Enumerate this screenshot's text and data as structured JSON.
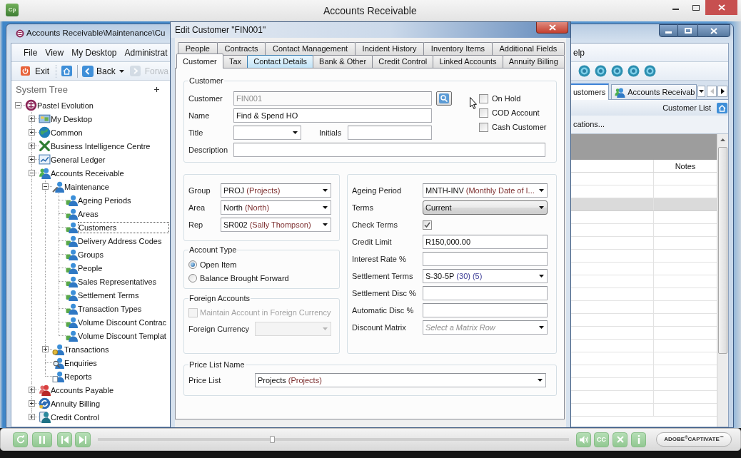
{
  "player": {
    "app_icon": "Cp",
    "title": "Accounts Receivable",
    "level": 0.37,
    "captions": "CC",
    "logo": "ADOBE$^{®}$CAPTIVATE$^{™}$"
  },
  "app_window": {
    "title": "Accounts Receivable\\Maintenance\\Cu",
    "menu": [
      "File",
      "View",
      "My Desktop",
      "Administrat"
    ],
    "menu_end": "elp",
    "toolbar": [
      {
        "kind": "button",
        "label": "Exit",
        "disabled": false
      },
      {
        "kind": "icon",
        "disabled": false
      },
      {
        "kind": "split",
        "label": "Back",
        "disabled": false
      },
      {
        "kind": "button",
        "label": "Forwa",
        "disabled": true
      }
    ],
    "system_tree": {
      "title": "System Tree",
      "items": [
        {
          "label": "Pastel Evolution",
          "expanded": true,
          "selected": false,
          "children": [
            {
              "label": "My Desktop",
              "expanded": false,
              "selected": false
            },
            {
              "label": "Common",
              "expanded": false,
              "selected": false
            },
            {
              "label": "Business Intelligence Centre",
              "expanded": false,
              "selected": false
            },
            {
              "label": "General Ledger",
              "expanded": false,
              "selected": false
            },
            {
              "label": "Accounts Receivable",
              "expanded": true,
              "selected": false,
              "children": [
                {
                  "label": "Maintenance",
                  "expanded": true,
                  "selected": false,
                  "children": [
                    {
                      "label": "Ageing Periods",
                      "selected": false
                    },
                    {
                      "label": "Areas",
                      "selected": false
                    },
                    {
                      "label": "Customers",
                      "selected": true
                    },
                    {
                      "label": "Delivery Address Codes",
                      "selected": false
                    },
                    {
                      "label": "Groups",
                      "selected": false
                    },
                    {
                      "label": "People",
                      "selected": false
                    },
                    {
                      "label": "Sales Representatives",
                      "selected": false
                    },
                    {
                      "label": "Settlement Terms",
                      "selected": false
                    },
                    {
                      "label": "Transaction Types",
                      "selected": false
                    },
                    {
                      "label": "Volume Discount Contrac",
                      "selected": false
                    },
                    {
                      "label": "Volume Discount Templat",
                      "selected": false
                    }
                  ]
                },
                {
                  "label": "Transactions",
                  "expanded": false,
                  "selected": false
                },
                {
                  "label": "Enquiries",
                  "selected": false
                },
                {
                  "label": "Reports",
                  "selected": false
                }
              ]
            },
            {
              "label": "Accounts Payable",
              "expanded": false,
              "selected": false
            },
            {
              "label": "Annuity Billing",
              "expanded": false,
              "selected": false
            },
            {
              "label": "Credit Control",
              "expanded": false,
              "selected": false
            }
          ]
        }
      ]
    },
    "document_tabs": [
      {
        "label": "ustomers",
        "selected": true
      },
      {
        "label": "Accounts Receivab",
        "selected": false
      }
    ],
    "tab_scroll_buttons": [
      {
        "disabled": true
      },
      {
        "disabled": false
      }
    ],
    "view_title": "Customer List",
    "filter_text": "cations...",
    "grid": {
      "columns": [
        "Notes"
      ],
      "rows": [
        {
          "selected": false
        },
        {
          "selected": false
        },
        {
          "selected": true
        },
        {
          "selected": false
        },
        {
          "selected": false
        },
        {
          "selected": false
        },
        {
          "selected": false
        },
        {
          "selected": false
        },
        {
          "selected": false
        },
        {
          "selected": false
        },
        {
          "selected": false
        },
        {
          "selected": false
        },
        {
          "selected": false
        },
        {
          "selected": false
        },
        {
          "selected": false
        },
        {
          "selected": false
        },
        {
          "selected": false
        },
        {
          "selected": false
        },
        {
          "selected": false
        }
      ]
    }
  },
  "dialog": {
    "title": "Edit Customer \"FIN001\"",
    "tab_rows": [
      {
        "tabs": [
          {
            "label": "People",
            "selected": false,
            "hovered": false
          },
          {
            "label": "Contracts",
            "selected": false,
            "hovered": false
          },
          {
            "label": "Contact Management",
            "selected": false,
            "hovered": false
          },
          {
            "label": "Incident History",
            "selected": false,
            "hovered": false
          },
          {
            "label": "Inventory Items",
            "selected": false,
            "hovered": false
          },
          {
            "label": "Additional Fields",
            "selected": false,
            "hovered": false
          }
        ]
      },
      {
        "tabs": [
          {
            "label": "Customer",
            "selected": true,
            "hovered": false
          },
          {
            "label": "Tax",
            "selected": false,
            "hovered": false
          },
          {
            "label": "Contact Details",
            "selected": false,
            "hovered": true
          },
          {
            "label": "Bank & Other",
            "selected": false,
            "hovered": false
          },
          {
            "label": "Credit Control",
            "selected": false,
            "hovered": false
          },
          {
            "label": "Linked Accounts",
            "selected": false,
            "hovered": false
          },
          {
            "label": "Annuity Billing",
            "selected": false,
            "hovered": false
          }
        ]
      }
    ],
    "customer": {
      "legend": "Customer",
      "code": {
        "label": "Customer",
        "value": "FIN001",
        "disabled": true
      },
      "name": {
        "label": "Name",
        "value": "Find & Spend HO",
        "disabled": false
      },
      "title": {
        "label": "Title"
      },
      "initials": {
        "label": "Initials"
      },
      "description": {
        "label": "Description"
      },
      "flags": [
        {
          "label": "On Hold",
          "checked": false
        },
        {
          "label": "COD Account",
          "checked": false
        },
        {
          "label": "Cash Customer",
          "checked": false
        }
      ]
    },
    "classification": [
      {
        "label": "Group",
        "value": "PROJ",
        "details": [
          "(Projects)"
        ]
      },
      {
        "label": "Area",
        "value": "North",
        "details": [
          "(North)"
        ]
      },
      {
        "label": "Rep",
        "value": "SR002",
        "details": [
          "(Sally Thompson)"
        ]
      }
    ],
    "account_type": {
      "legend": "Account Type",
      "options": [
        {
          "label": "Open Item",
          "selected": true
        },
        {
          "label": "Balance Brought Forward",
          "selected": false
        }
      ]
    },
    "foreign_accounts": {
      "legend": "Foreign Accounts",
      "maintain": {
        "label": "Maintain Account in Foreign Currency",
        "checked": false,
        "disabled": true
      },
      "currency": {
        "label": "Foreign Currency",
        "disabled": true
      }
    },
    "terms": [
      {
        "kind": "dropdown",
        "label": "Ageing Period",
        "value": "MNTH-INV",
        "details": [
          "(Monthly Date of I..."
        ]
      },
      {
        "kind": "combo",
        "label": "Terms",
        "value": "Current"
      },
      {
        "kind": "checkbox",
        "label": "Check Terms",
        "checked": true
      },
      {
        "kind": "input",
        "label": "Credit Limit",
        "value": "R150,000.00"
      },
      {
        "kind": "input",
        "label": "Interest Rate %"
      },
      {
        "kind": "dropdown",
        "label": "Settlement Terms",
        "value": "S-30-5P",
        "details": [
          "(30)",
          "(5)"
        ],
        "color": "#3b3b96"
      },
      {
        "kind": "input",
        "label": "Settlement Disc %"
      },
      {
        "kind": "input",
        "label": "Automatic Disc %"
      },
      {
        "kind": "dropdown",
        "label": "Discount Matrix",
        "placeholder": "Select a Matrix Row"
      }
    ],
    "price_list": {
      "legend": "Price List Name",
      "label": "Price List",
      "value": "Projects",
      "details": [
        "(Projects)"
      ]
    }
  }
}
